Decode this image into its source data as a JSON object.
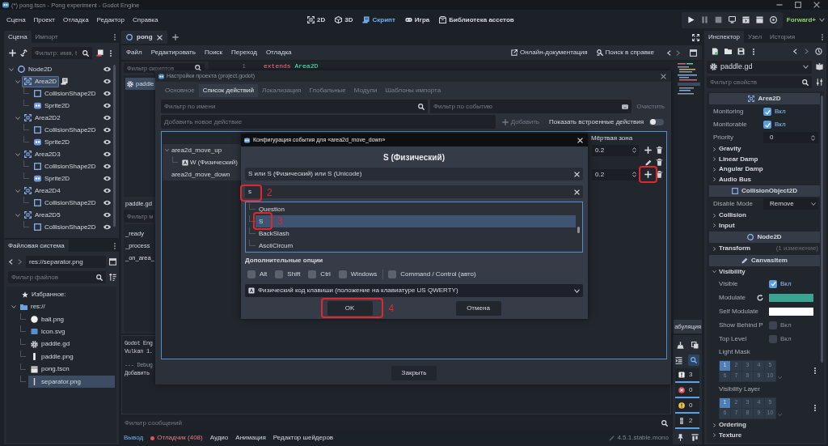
{
  "window": {
    "title": "(*) pong.tscn - Pong experiment - Godot Engine"
  },
  "top_bar": {
    "menus": [
      "Сцена",
      "Проект",
      "Отладка",
      "Редактор",
      "Справка"
    ],
    "workspaces": [
      {
        "kind": "canvas",
        "label": "2D",
        "selected": false
      },
      {
        "kind": "spatial",
        "label": "3D",
        "selected": false
      },
      {
        "kind": "script",
        "label": "Скрипт",
        "selected": true
      },
      {
        "kind": "game",
        "label": "Игра",
        "selected": false
      },
      {
        "kind": "assets",
        "label": "Библиотека ассетов",
        "selected": false
      }
    ],
    "renderer": "Forward+"
  },
  "scene_dock": {
    "tabs": [
      {
        "label": "Сцена",
        "selected": true
      },
      {
        "label": "Импорт",
        "selected": false
      }
    ],
    "filter_placeholder": "Фильтр: имя, t",
    "tree": [
      {
        "label": "Node2D",
        "kind": "node2d",
        "selected": false,
        "script": false,
        "expanded": true,
        "children": [
          {
            "label": "Area2D",
            "kind": "area",
            "selected": true,
            "script": true,
            "expanded": true,
            "children": [
              {
                "label": "CollisionShape2D",
                "kind": "collision",
                "selected": false,
                "script": false
              },
              {
                "label": "Sprite2D",
                "kind": "sprite",
                "selected": false,
                "script": false
              }
            ]
          },
          {
            "label": "Area2D2",
            "kind": "area",
            "selected": false,
            "script": false,
            "expanded": true,
            "children": [
              {
                "label": "CollisionShape2D",
                "kind": "collision",
                "selected": false,
                "script": false
              },
              {
                "label": "Sprite2D",
                "kind": "sprite",
                "selected": false,
                "script": false
              }
            ]
          },
          {
            "label": "Area2D3",
            "kind": "area",
            "selected": false,
            "script": false,
            "expanded": true,
            "children": [
              {
                "label": "CollisionShape2D",
                "kind": "collision",
                "selected": false,
                "script": false
              },
              {
                "label": "Sprite2D",
                "kind": "sprite",
                "selected": false,
                "script": false
              }
            ]
          },
          {
            "label": "Area2D4",
            "kind": "area",
            "selected": false,
            "script": false,
            "expanded": true,
            "children": [
              {
                "label": "CollisionShape2D",
                "kind": "collision",
                "selected": false,
                "script": false
              }
            ]
          },
          {
            "label": "Area2D5",
            "kind": "area",
            "selected": false,
            "script": false,
            "expanded": true,
            "children": [
              {
                "label": "CollisionShape2D",
                "kind": "collision",
                "selected": false,
                "script": false
              }
            ]
          }
        ]
      }
    ]
  },
  "filesystem": {
    "tab": "Файловая система",
    "path": "res://separator.png",
    "filter_placeholder": "Фильтр файлов",
    "favorites": "Избранное:",
    "tree": [
      {
        "label": "res://",
        "kind": "folder",
        "selected": false,
        "expanded": true,
        "children": [
          {
            "label": "ball.png",
            "kind": "ball",
            "selected": false
          },
          {
            "label": "icon.svg",
            "kind": "svg",
            "selected": false
          },
          {
            "label": "paddle.gd",
            "kind": "script",
            "selected": false
          },
          {
            "label": "paddle.png",
            "kind": "bar",
            "selected": false
          },
          {
            "label": "pong.tscn",
            "kind": "scene",
            "selected": false
          },
          {
            "label": "separator.png",
            "kind": "line",
            "selected": true
          }
        ]
      }
    ]
  },
  "script_editor": {
    "tabs": [
      {
        "label": "pong",
        "selected": true
      }
    ],
    "menus": [
      "Файл",
      "Редактировать",
      "Поиск",
      "Переход",
      "Отладка"
    ],
    "doc_link": "Онлайн-документация",
    "help_search": "Поиск в справке",
    "script_filter_placeholder": "Фильтр скриптов",
    "scripts": [
      {
        "label": "paddle",
        "selected": true
      }
    ],
    "current_script": "paddle.gd",
    "method_filter_placeholder": "Фильтр м",
    "methods": [
      "_ready",
      "_process",
      "_on_area_"
    ],
    "code_lines": [
      {
        "number": "1",
        "keyword": "extends",
        "text": "Area2D"
      }
    ],
    "indent_button": "абуляция"
  },
  "bottom_panel": {
    "output_lines": [
      "Godot Eng",
      "Vulkan 1.",
      "--- Debug",
      "Добавить"
    ],
    "filter_placeholder": "Фильтр сообщений",
    "tabs": [
      {
        "label": "Вывод",
        "selected": true,
        "alert": false
      },
      {
        "label": "Отладчик (408)",
        "selected": false,
        "alert": true
      },
      {
        "label": "Аудио",
        "selected": false,
        "alert": false
      },
      {
        "label": "Анимация",
        "selected": false,
        "alert": false
      },
      {
        "label": "Редактор шейдеров",
        "selected": false,
        "alert": false
      }
    ],
    "version": "4.5.1.stable.mono",
    "search_on": true,
    "counters": [
      {
        "kind": "message",
        "count": "3",
        "on": true
      },
      {
        "kind": "error",
        "count": "0",
        "on": true
      },
      {
        "kind": "warning",
        "count": "0",
        "on": true
      },
      {
        "kind": "editor",
        "count": "2",
        "on": true
      }
    ]
  },
  "inspector": {
    "tabs": [
      {
        "label": "Инспектор",
        "selected": true
      },
      {
        "label": "Узел",
        "selected": false
      },
      {
        "label": "История",
        "selected": false
      }
    ],
    "resource": "paddle.gd",
    "filter_placeholder": "Фильтр свойств",
    "sections": [
      {
        "kind": "area",
        "label": "Area2D",
        "rows": [
          {
            "kind": "check",
            "label": "Monitoring",
            "checked": true,
            "value": "Вкл"
          },
          {
            "kind": "check",
            "label": "Monitorable",
            "checked": true,
            "value": "Вкл"
          },
          {
            "kind": "number",
            "label": "Priority",
            "value": "0"
          },
          {
            "kind": "group",
            "label": "Gravity",
            "expanded": false
          },
          {
            "kind": "group",
            "label": "Linear Damp",
            "expanded": false
          },
          {
            "kind": "group",
            "label": "Angular Damp",
            "expanded": false
          },
          {
            "kind": "group",
            "label": "Audio Bus",
            "expanded": false
          }
        ]
      },
      {
        "kind": "collision",
        "label": "CollisionObject2D",
        "rows": [
          {
            "kind": "select",
            "label": "Disable Mode",
            "value": "Remove"
          },
          {
            "kind": "group",
            "label": "Collision",
            "expanded": false
          },
          {
            "kind": "group",
            "label": "Input",
            "expanded": false
          }
        ]
      },
      {
        "kind": "node2d",
        "label": "Node2D",
        "rows": [
          {
            "kind": "group",
            "label": "Transform",
            "expanded": false,
            "note": "(1 изменение)"
          }
        ]
      },
      {
        "kind": "canvas",
        "label": "CanvasItem",
        "rows": [
          {
            "kind": "group",
            "label": "Visibility",
            "expanded": true,
            "children": [
              {
                "kind": "check",
                "label": "Visible",
                "checked": true,
                "value": "Вкл"
              },
              {
                "kind": "color",
                "label": "Modulate",
                "color": "#3aa391",
                "revertable": true
              },
              {
                "kind": "color",
                "label": "Self Modulate",
                "color": "#ffffff",
                "revertable": false
              },
              {
                "kind": "check",
                "label": "Show Behind P",
                "checked": false,
                "value": "Вкл"
              },
              {
                "kind": "check",
                "label": "Top Level",
                "checked": false,
                "value": "Вкл"
              },
              {
                "kind": "layers",
                "label": "Light Mask",
                "cells": [
                  {
                    "label": "1",
                    "selected": true
                  },
                  {
                    "label": "2",
                    "selected": false
                  },
                  {
                    "label": "3",
                    "selected": false
                  },
                  {
                    "label": "4",
                    "selected": false
                  },
                  {
                    "label": "5",
                    "selected": false
                  },
                  {
                    "label": "6",
                    "selected": false
                  },
                  {
                    "label": "7",
                    "selected": false
                  },
                  {
                    "label": "8",
                    "selected": false
                  },
                  {
                    "label": "9",
                    "selected": false
                  },
                  {
                    "label": "10",
                    "selected": false
                  }
                ]
              },
              {
                "kind": "layers",
                "label": "Visibility Layer",
                "cells": [
                  {
                    "label": "1",
                    "selected": true
                  },
                  {
                    "label": "2",
                    "selected": false
                  },
                  {
                    "label": "3",
                    "selected": false
                  },
                  {
                    "label": "4",
                    "selected": false
                  },
                  {
                    "label": "5",
                    "selected": false
                  },
                  {
                    "label": "6",
                    "selected": false
                  },
                  {
                    "label": "7",
                    "selected": false
                  },
                  {
                    "label": "8",
                    "selected": false
                  },
                  {
                    "label": "9",
                    "selected": false
                  },
                  {
                    "label": "10",
                    "selected": false
                  }
                ]
              }
            ]
          },
          {
            "kind": "group",
            "label": "Ordering",
            "expanded": false
          },
          {
            "kind": "group",
            "label": "Texture",
            "expanded": false
          }
        ]
      }
    ]
  },
  "project_settings": {
    "title": "Настройки проекта (project.godot)",
    "tabs": [
      {
        "label": "Основное",
        "selected": false
      },
      {
        "label": "Список действий",
        "selected": true
      },
      {
        "label": "Локализация",
        "selected": false
      },
      {
        "label": "Глобальные",
        "selected": false
      },
      {
        "label": "Модули",
        "selected": false
      },
      {
        "label": "Шаблоны импорта",
        "selected": false
      }
    ],
    "name_filter_placeholder": "Фильтр по имени",
    "event_filter_placeholder": "Фильтр по событию",
    "clear_button": {
      "label": "Очистить",
      "disabled": true
    },
    "new_action_placeholder": "Добавить новое действие",
    "add_button": {
      "label": "Добавить",
      "disabled": true
    },
    "builtin_toggle": {
      "label": "Показать встроенные действия",
      "on": false
    },
    "deadzone_header": "Мёртвая зона",
    "actions": [
      {
        "name": "area2d_move_up",
        "expanded": true,
        "deadzone": "0.2",
        "add_marked": false,
        "events": [
          {
            "label": "W (Физический)"
          }
        ]
      },
      {
        "name": "area2d_move_down",
        "deadzone": "0.2",
        "add_marked": true
      }
    ],
    "close_button": "Закрыть"
  },
  "event_dialog": {
    "title": "Конфигурация события для «area2d_move_down»",
    "heading": "S (Физический)",
    "event_text": "S или S (Физический) или S (Unicode)",
    "search": {
      "value": "s",
      "marked": true,
      "callout": "2"
    },
    "keys": [
      {
        "label": "Question",
        "selected": false,
        "marked": false
      },
      {
        "label": "S",
        "selected": true,
        "marked": true,
        "callout": "3"
      },
      {
        "label": "BackSlash",
        "selected": false,
        "marked": false
      },
      {
        "label": "AsciiCircum",
        "selected": false,
        "marked": false
      }
    ],
    "options_heading": "Дополнительные опции",
    "modifiers": [
      {
        "label": "Alt",
        "checked": false
      },
      {
        "label": "Shift",
        "checked": false
      },
      {
        "label": "Ctrl",
        "checked": false
      },
      {
        "label": "Windows",
        "checked": false
      },
      {
        "label": "Command / Control (авто)",
        "checked": false
      }
    ],
    "key_mode": "Физический код клавиши (положение на клавиатуре US QWERTY)",
    "ok_button": {
      "label": "OK",
      "marked": true,
      "callout": "4"
    },
    "cancel_button": "Отмена"
  }
}
